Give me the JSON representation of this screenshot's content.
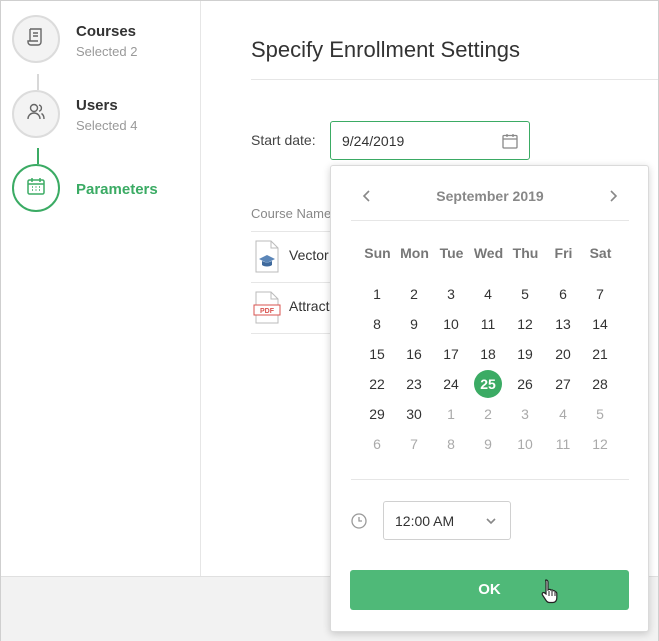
{
  "steps": [
    {
      "title": "Courses",
      "subtitle": "Selected 2",
      "icon": "scroll-icon"
    },
    {
      "title": "Users",
      "subtitle": "Selected 4",
      "icon": "users-icon"
    },
    {
      "title": "Parameters",
      "subtitle": "",
      "icon": "calendar-icon",
      "active": true
    }
  ],
  "main": {
    "title": "Specify Enrollment Settings",
    "start_date_label": "Start date:",
    "start_date_value": "9/24/2019",
    "course_name_header": "Course Name",
    "courses": [
      {
        "name": "Vector",
        "icon": "course-graduation-icon"
      },
      {
        "name": "Attract",
        "icon": "pdf-file-icon"
      }
    ]
  },
  "calendar": {
    "month_label": "September 2019",
    "weekdays": [
      "Sun",
      "Mon",
      "Tue",
      "Wed",
      "Thu",
      "Fri",
      "Sat"
    ],
    "weeks": [
      [
        {
          "d": "1"
        },
        {
          "d": "2"
        },
        {
          "d": "3"
        },
        {
          "d": "4"
        },
        {
          "d": "5"
        },
        {
          "d": "6"
        },
        {
          "d": "7"
        }
      ],
      [
        {
          "d": "8"
        },
        {
          "d": "9"
        },
        {
          "d": "10"
        },
        {
          "d": "11"
        },
        {
          "d": "12"
        },
        {
          "d": "13"
        },
        {
          "d": "14"
        }
      ],
      [
        {
          "d": "15"
        },
        {
          "d": "16"
        },
        {
          "d": "17"
        },
        {
          "d": "18"
        },
        {
          "d": "19"
        },
        {
          "d": "20"
        },
        {
          "d": "21"
        }
      ],
      [
        {
          "d": "22"
        },
        {
          "d": "23"
        },
        {
          "d": "24"
        },
        {
          "d": "25",
          "sel": true
        },
        {
          "d": "26"
        },
        {
          "d": "27"
        },
        {
          "d": "28"
        }
      ],
      [
        {
          "d": "29"
        },
        {
          "d": "30"
        },
        {
          "d": "1",
          "muted": true
        },
        {
          "d": "2",
          "muted": true
        },
        {
          "d": "3",
          "muted": true
        },
        {
          "d": "4",
          "muted": true
        },
        {
          "d": "5",
          "muted": true
        }
      ],
      [
        {
          "d": "6",
          "muted": true
        },
        {
          "d": "7",
          "muted": true
        },
        {
          "d": "8",
          "muted": true
        },
        {
          "d": "9",
          "muted": true
        },
        {
          "d": "10",
          "muted": true
        },
        {
          "d": "11",
          "muted": true
        },
        {
          "d": "12",
          "muted": true
        }
      ]
    ],
    "time_value": "12:00 AM",
    "ok_label": "OK"
  },
  "colors": {
    "accent": "#3bab64",
    "ok_button": "#4fb978",
    "muted_text": "#aaaaaa"
  }
}
